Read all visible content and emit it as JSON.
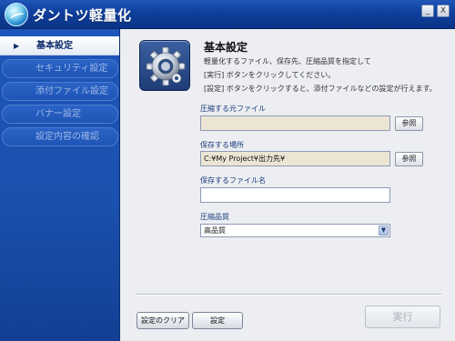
{
  "window": {
    "title": "ダントツ軽量化",
    "minimize_label": "_",
    "close_label": "X"
  },
  "sidebar": {
    "active_marker": "▶",
    "items": [
      {
        "label": "基本設定",
        "active": true
      },
      {
        "label": "セキュリティ設定",
        "active": false
      },
      {
        "label": "添付ファイル設定",
        "active": false
      },
      {
        "label": "バナー設定",
        "active": false
      },
      {
        "label": "設定内容の確認",
        "active": false
      }
    ]
  },
  "main": {
    "icon": "gear-icon",
    "title": "基本設定",
    "description": [
      "軽量化するファイル、保存先、圧縮品質を指定して",
      "[実行] ボタンをクリックしてください。",
      "[設定] ボタンをクリックすると、添付ファイルなどの設定が行えます。"
    ],
    "source_file": {
      "label": "圧縮する元ファイル",
      "value": "",
      "browse_label": "参照"
    },
    "save_location": {
      "label": "保存する場所",
      "value": "C:¥My Project¥出力先¥",
      "browse_label": "参照"
    },
    "save_filename": {
      "label": "保存するファイル名",
      "value": ""
    },
    "quality": {
      "label": "圧縮品質",
      "value": "高品質"
    }
  },
  "buttons": {
    "clear_label": "設定のクリア",
    "settings_label": "設定",
    "run_label": "実行"
  },
  "colors": {
    "titlebar": "#0f3f9c",
    "sidebar": "#1b50ae",
    "field_disabled": "#ece5d3"
  }
}
